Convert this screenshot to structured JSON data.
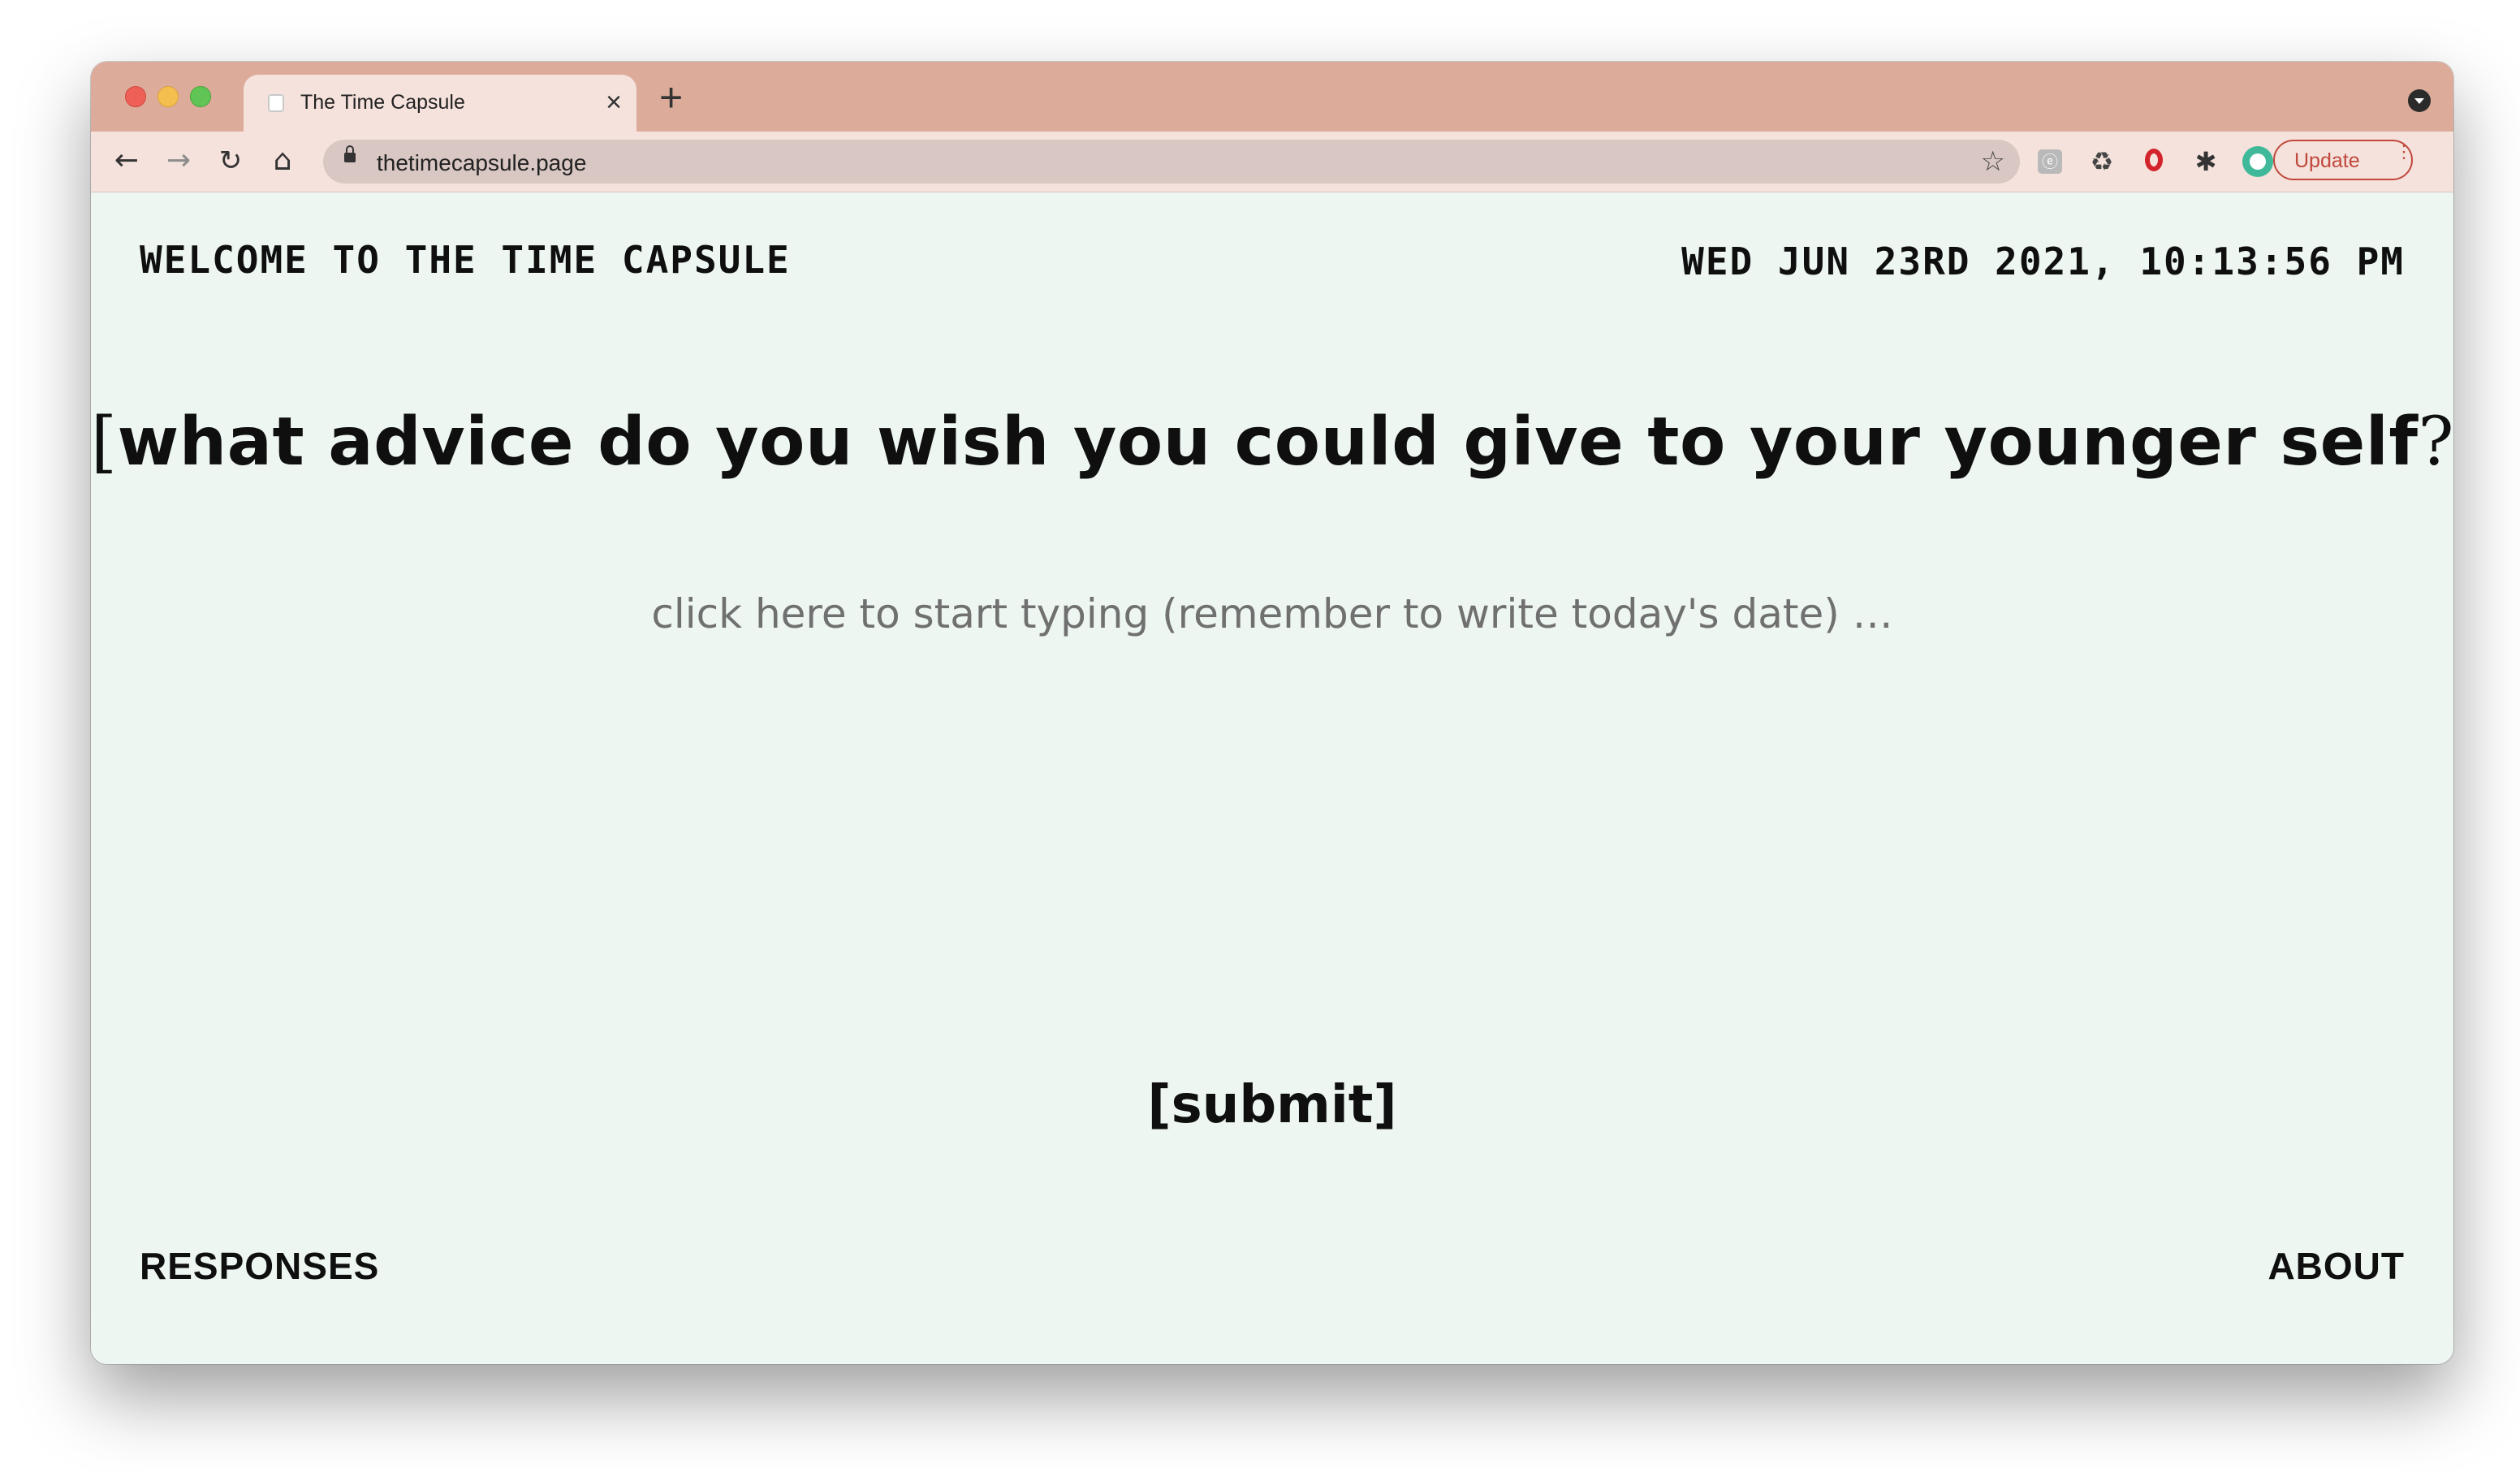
{
  "browser": {
    "tab_title": "The Time Capsule",
    "tab_close": "×",
    "new_tab": "+",
    "url": "thetimecapsule.page",
    "update_label": "Update",
    "update_menu": "⋮",
    "nav": {
      "back": "←",
      "forward": "→",
      "reload": "↻",
      "home": "⌂"
    },
    "bookmark_star": "☆",
    "extensions": [
      "extension-gray-icon",
      "recycle-icon",
      "opera-icon",
      "puzzle-icon",
      "profile-avatar-icon"
    ],
    "colors": {
      "tabstrip": "#dcab9a",
      "toolbar": "#f5e2dc",
      "update_accent": "#c0483c"
    }
  },
  "header": {
    "welcome": "WELCOME TO THE TIME CAPSULE",
    "datetime": "WED JUN 23RD 2021, 10:13:56 PM"
  },
  "main": {
    "question_open": "[",
    "question": "what advice do you wish you could give to your younger self",
    "question_mark": "?",
    "question_close": "]",
    "answer_placeholder": "click here to start typing (remember to write today's date) …",
    "submit_label": "[submit]"
  },
  "footer": {
    "responses": "RESPONSES",
    "about": "ABOUT"
  },
  "colors": {
    "page_background": "#edf6f0",
    "text": "#0f0f0f"
  }
}
